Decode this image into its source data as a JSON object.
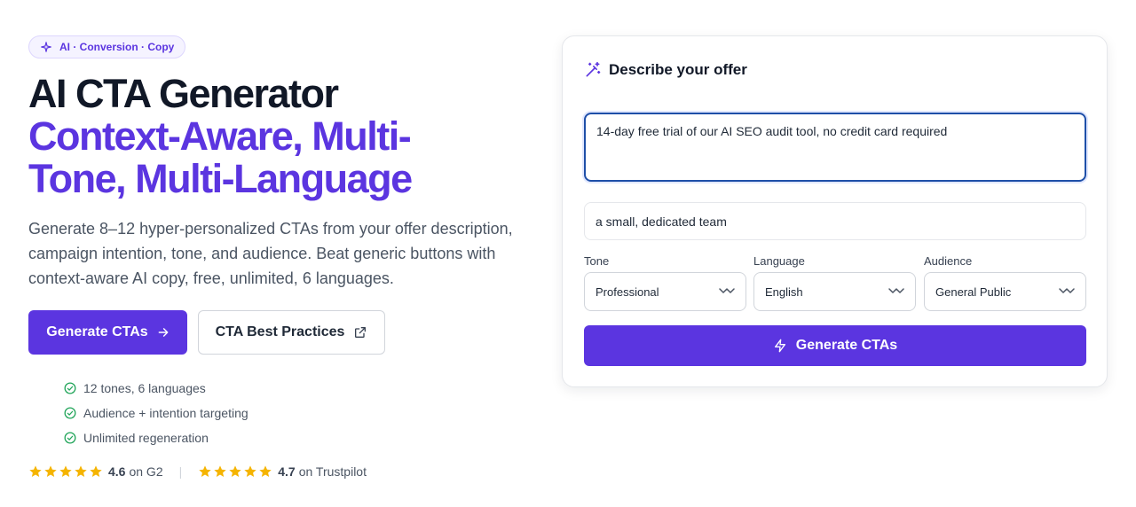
{
  "badge": {
    "text": "AI · Conversion · Copy",
    "icon": "sparkle-icon"
  },
  "hero": {
    "title_line1": "AI CTA Generator",
    "title_line2": "Context-Aware, Multi-",
    "title_line3": "Tone, Multi-Language",
    "subtitle": "Generate 8–12 hyper-personalized CTAs from your offer description, campaign intention, tone, and audience. Beat generic buttons with context-aware AI copy, free, unlimited, 6 languages."
  },
  "buttons": {
    "primary_label": "Generate CTAs",
    "secondary_label": "CTA Best Practices"
  },
  "features": [
    "12 tones, 6 languages",
    "Audience + intention targeting",
    "Unlimited regeneration"
  ],
  "ratings": [
    {
      "score": "4.6",
      "source": "on G2",
      "stars": 5
    },
    {
      "score": "4.7",
      "source": "on Trustpilot",
      "stars": 5
    }
  ],
  "form": {
    "title": "Describe your offer",
    "offer_value": "14-day free trial of our AI SEO audit tool, no credit card required",
    "team_value": "a small, dedicated team",
    "tone_label": "Tone",
    "tone_value": "Professional",
    "language_label": "Language",
    "language_value": "English",
    "audience_label": "Audience",
    "audience_value": "General Public",
    "submit_label": "Generate CTAs"
  },
  "colors": {
    "accent": "#5b35e0",
    "star": "#f5b400",
    "check": "#22a55a"
  }
}
